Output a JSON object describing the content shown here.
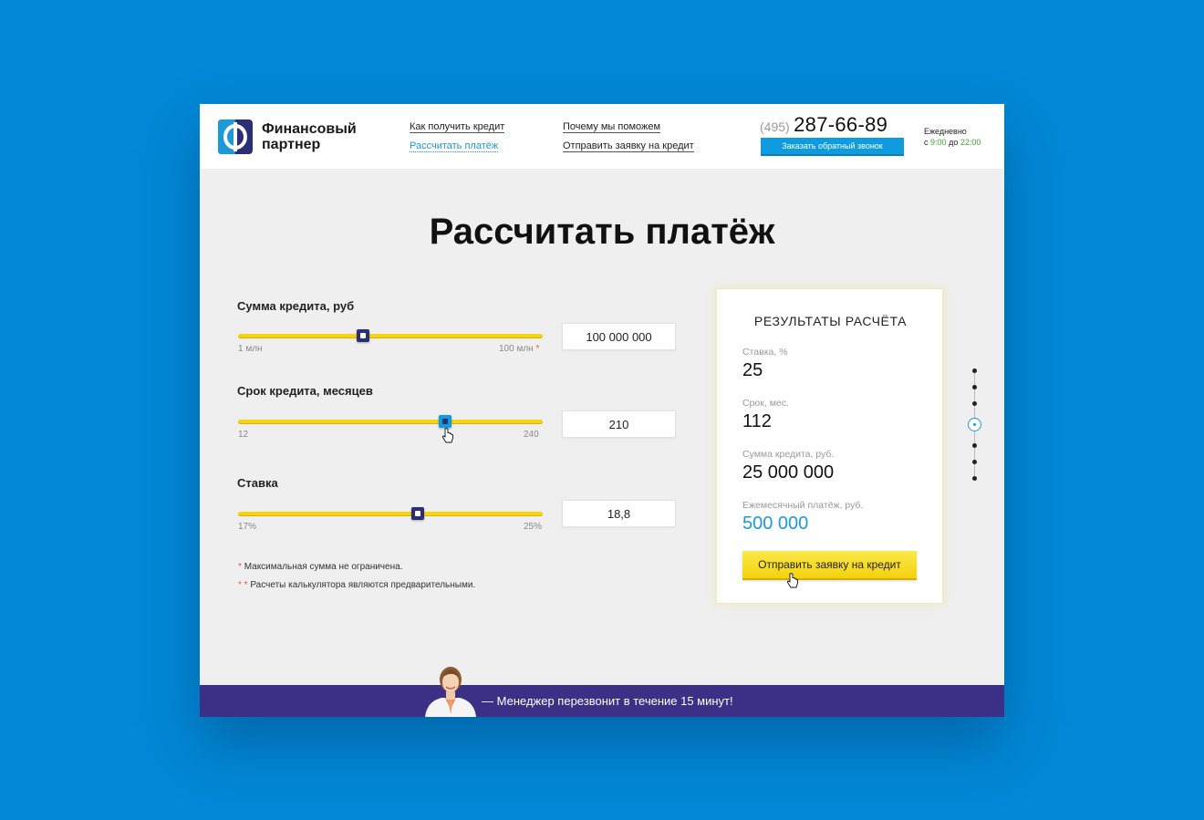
{
  "brand": {
    "name_line1": "Финансовый",
    "name_line2": "партнер",
    "colors": {
      "blue": "#1a9ad6",
      "navy": "#2c2f75",
      "yellow": "#f6d40e",
      "background": "#0288d6"
    }
  },
  "nav": {
    "how_to_get": "Как получить кредит",
    "calculate": "Рассчитать платёж",
    "why_help": "Почему мы поможем",
    "send_request": "Отправить заявку на кредит"
  },
  "contact": {
    "phone_code": "(495)",
    "phone_number": "287-66-89",
    "callback_label": "Заказать обратный звонок",
    "hours_line1": "Ежедневно",
    "hours_prefix": "с",
    "hours_from": "9:00",
    "hours_mid": "до",
    "hours_to": "22:00"
  },
  "page_title": "Рассчитать платёж",
  "calculator": {
    "amount": {
      "label": "Сумма кредита, руб",
      "min_label": "1 млн",
      "max_label": "100 млн",
      "max_mark": "*",
      "value": "100 000 000",
      "slider_fraction": 0.41
    },
    "term": {
      "label": "Срок кредита, месяцев",
      "min_label": "12",
      "max_label": "240",
      "value": "210",
      "slider_fraction": 0.68
    },
    "rate": {
      "label": "Ставка",
      "min_label": "17%",
      "max_label": "25%",
      "value": "18,8",
      "slider_fraction": 0.59
    }
  },
  "notes": {
    "note1_mark": "*",
    "note1": "Максимальная сумма не ограничена.",
    "note2_mark": "* *",
    "note2": "Расчеты калькулятора являются предварительными."
  },
  "results": {
    "title": "РЕЗУЛЬТАТЫ РАСЧЁТА",
    "rate_label": "Ставка, %",
    "rate_value": "25",
    "term_label": "Срок, мес.",
    "term_value": "112",
    "amount_label": "Сумма кредита, руб.",
    "amount_value": "25 000 000",
    "payment_label": "Ежемесячный платёж, руб.",
    "payment_value": "500 000",
    "submit_label": "Отправить заявку на кредит"
  },
  "side_nav": {
    "count": 7,
    "active_index": 3
  },
  "footer": {
    "text": "—  Менеджер перезвонит в течение 15 минут!"
  },
  "icons": [
    "logo-icon",
    "pointer-cursor-icon",
    "manager-avatar"
  ]
}
